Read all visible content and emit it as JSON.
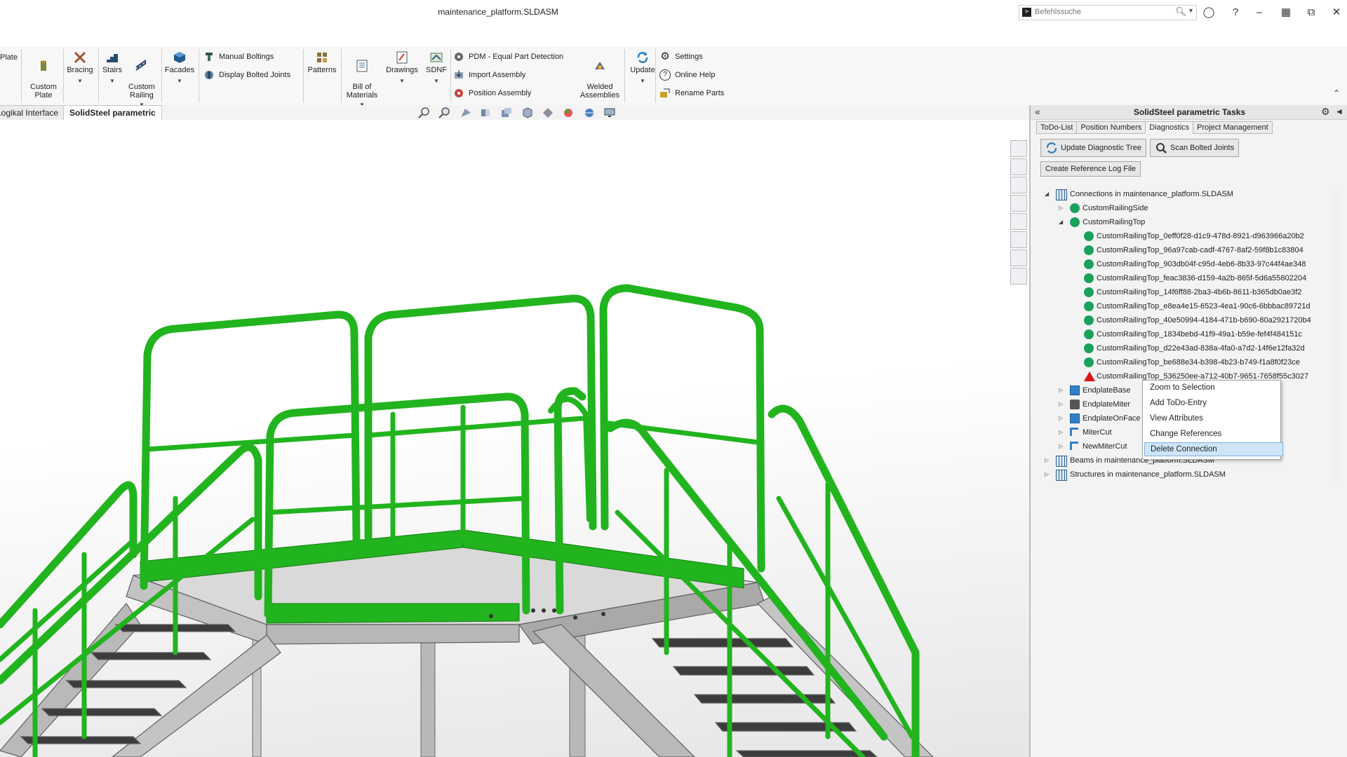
{
  "window": {
    "title": "maintenance_platform.SLDASM"
  },
  "search": {
    "placeholder": "Befehlssuche"
  },
  "ribbon": {
    "plate_label": "Plate",
    "custom_plate": "Custom\nPlate",
    "bracing": "Bracing",
    "stairs": "Stairs",
    "custom_railing": "Custom\nRailing",
    "facades": "Facades",
    "manual_boltings": "Manual Boltings",
    "display_bolted_joints": "Display Bolted Joints",
    "patterns": "Patterns",
    "bill_of_materials": "Bill of\nMaterials",
    "drawings": "Drawings",
    "sdnf": "SDNF",
    "pdm_equal_part_detection": "PDM - Equal Part Detection",
    "import_assembly": "Import Assembly",
    "position_assembly": "Position Assembly",
    "welded_assemblies": "Welded\nAssemblies",
    "update": "Update",
    "settings": "Settings",
    "online_help": "Online Help",
    "rename_parts": "Rename Parts"
  },
  "feature_tabs": [
    "Logikal Interface",
    "SolidSteel parametric"
  ],
  "pane": {
    "title": "SolidSteel parametric Tasks",
    "tabs": [
      "ToDo-List",
      "Position Numbers",
      "Diagnostics",
      "Project Management"
    ],
    "active_tab": "Diagnostics",
    "buttons": {
      "update_tree": "Update Diagnostic Tree",
      "scan_bolted": "Scan Bolted Joints",
      "create_log": "Create Reference Log File"
    },
    "tree": {
      "root": "Connections in maintenance_platform.SLDASM",
      "side": "CustomRailingSide",
      "top": "CustomRailingTop",
      "top_items": [
        "CustomRailingTop_0eff0f28-d1c9-478d-8921-d963966a20b2",
        "CustomRailingTop_96a97cab-cadf-4767-8af2-59f8b1c83804",
        "CustomRailingTop_903db04f-c95d-4eb6-8b33-97c44f4ae348",
        "CustomRailingTop_feac3836-d159-4a2b-865f-5d6a55802204",
        "CustomRailingTop_14f6ff88-2ba3-4b6b-8611-b365db0ae3f2",
        "CustomRailingTop_e8ea4e15-6523-4ea1-90c6-6bbbac89721d",
        "CustomRailingTop_40e50994-4184-471b-b690-80a2921720b4",
        "CustomRailingTop_1834bebd-41f9-49a1-b59e-fef4f484151c",
        "CustomRailingTop_d22e43ad-838a-4fa0-a7d2-14f6e12fa32d",
        "CustomRailingTop_be688e34-b398-4b23-b749-f1a8f0f23ce",
        "CustomRailingTop_536250ee-a712-40b7-9651-7658f55c3027"
      ],
      "endplate_base": "EndplateBase",
      "endplate_miter": "EndplateMiter",
      "endplate_on_face": "EndplateOnFace",
      "miter_cut": "MiterCut",
      "new_miter_cut": "NewMiterCut",
      "beams": "Beams in maintenance_platform.SLDASM",
      "structures": "Structures in maintenance_platform.SLDASM"
    }
  },
  "context_menu": {
    "items": [
      "Zoom to Selection",
      "Add ToDo-Entry",
      "View Attributes",
      "Change References",
      "Delete Connection"
    ],
    "highlighted": "Delete Connection"
  },
  "colors": {
    "railing_green": "#22b41e",
    "steel_grey": "#b9b9b9",
    "status_ok": "#1aa15c",
    "status_error": "#e01414"
  }
}
